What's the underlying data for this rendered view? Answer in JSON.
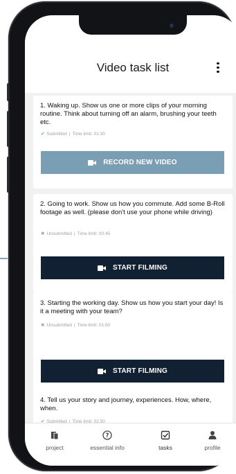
{
  "header": {
    "title": "Video task list"
  },
  "tasks": [
    {
      "text": "1.  Waking up. Show us one or more clips of your morning routine. Think about turning off an alarm, brushing your teeth etc.",
      "status": "Submitted",
      "separator": "|",
      "time_limit": "Time limit: 01:30",
      "button": "RECORD NEW VIDEO"
    },
    {
      "text": "2. Going to work. Show us how you commute. Add some B-Roll footage as well. (please don't use your phone while driving)",
      "status": "Unsubmitted",
      "separator": "|",
      "time_limit": "Time limit: 00:45",
      "button": "START FILMING"
    },
    {
      "text": "3.  Starting the working day. Show us how you start your day! Is it a meeting with your team?",
      "status": "Unsubmitted",
      "separator": "|",
      "time_limit": "Time limit: 01:00",
      "button": "START FILMING"
    },
    {
      "text": "4.  Tell us your story and journey, experiences. How, where, when.",
      "status": "Submitted",
      "separator": "|",
      "time_limit": "Time limit: 02:50"
    }
  ],
  "tabbar": {
    "items": [
      {
        "label": "project",
        "icon": "project-icon"
      },
      {
        "label": "essential info",
        "icon": "question-icon"
      },
      {
        "label": "tasks",
        "icon": "tasks-icon"
      },
      {
        "label": "profile",
        "icon": "profile-icon"
      }
    ],
    "active": "tasks"
  },
  "colors": {
    "button_record": "#7a9fb5",
    "button_filming": "#112033",
    "submitted": "#5cb85c",
    "unsubmitted": "#9aa0a6",
    "arrow": "#3d6f94"
  }
}
